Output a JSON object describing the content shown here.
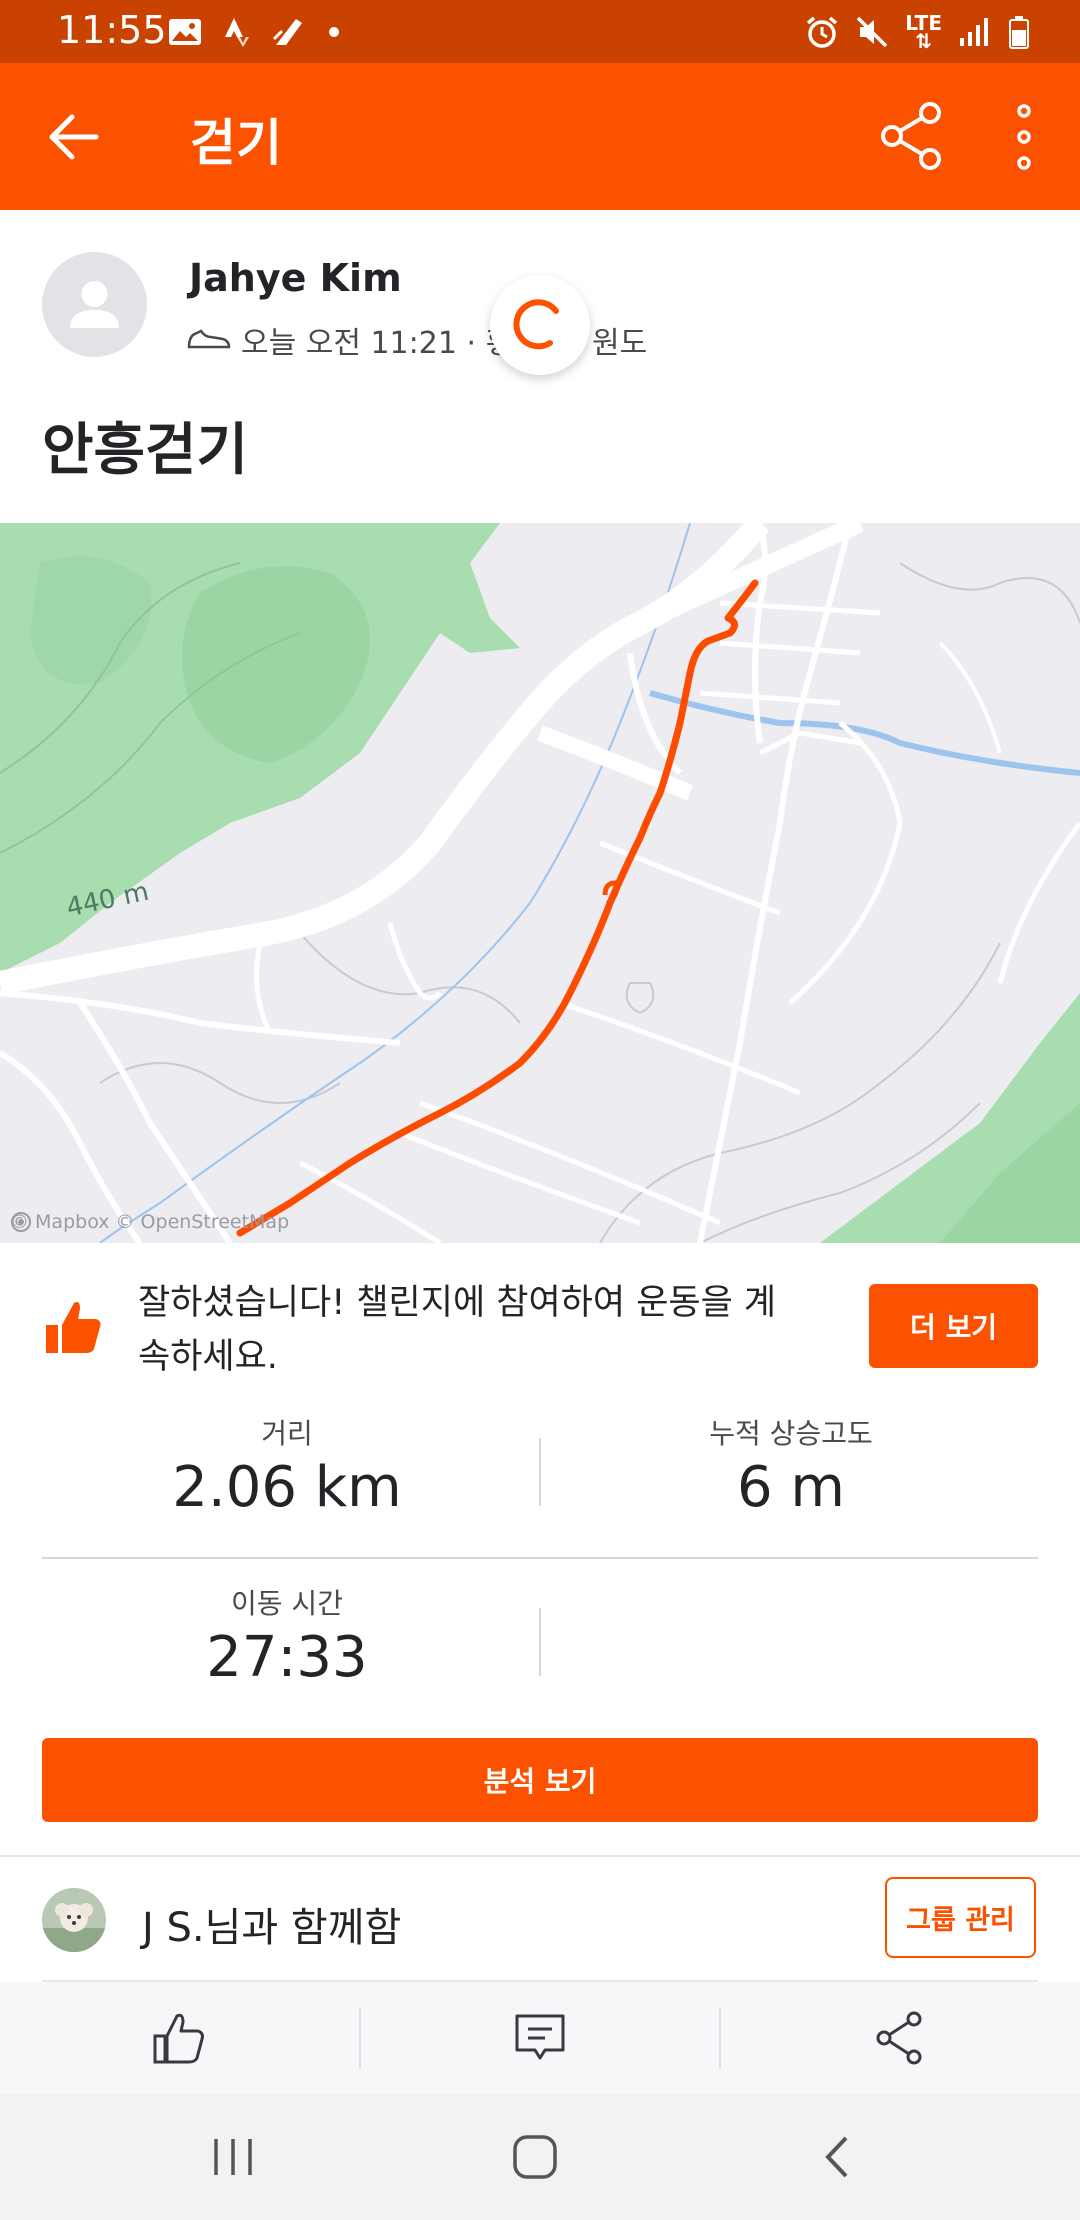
{
  "status_bar": {
    "time": "11:55",
    "network": "LTE",
    "left_icons": [
      "gallery-icon",
      "strava-icon",
      "nike-icon",
      "dot-icon"
    ],
    "right_icons": [
      "alarm-icon",
      "mute-icon",
      "lte-icon",
      "signal-icon",
      "battery-icon"
    ]
  },
  "app_bar": {
    "title": "걷기"
  },
  "header": {
    "athlete_name": "Jahye Kim",
    "meta_prefix": "오늘 오전 11:21 · 횡",
    "meta_suffix": "원도"
  },
  "activity": {
    "title": "안흥걷기"
  },
  "map": {
    "elevation_label": "440 m",
    "attribution": "© Mapbox © OpenStreetMap"
  },
  "challenge": {
    "text": "잘하셨습니다! 챌린지에 참여하여 운동을 계속하세요.",
    "button_label": "더 보기"
  },
  "stats": {
    "distance": {
      "label": "거리",
      "value": "2.06 km"
    },
    "elevation_gain": {
      "label": "누적 상승고도",
      "value": "6 m"
    },
    "moving_time": {
      "label": "이동 시간",
      "value": "27:33"
    }
  },
  "analysis_button": "분석 보기",
  "group": {
    "text": "J S.님과 함께함",
    "button_label": "그룹 관리"
  },
  "colors": {
    "accent": "#fc5200",
    "status_bar": "#c94200",
    "route": "#fc4c02",
    "park": "#a8ddb0"
  }
}
